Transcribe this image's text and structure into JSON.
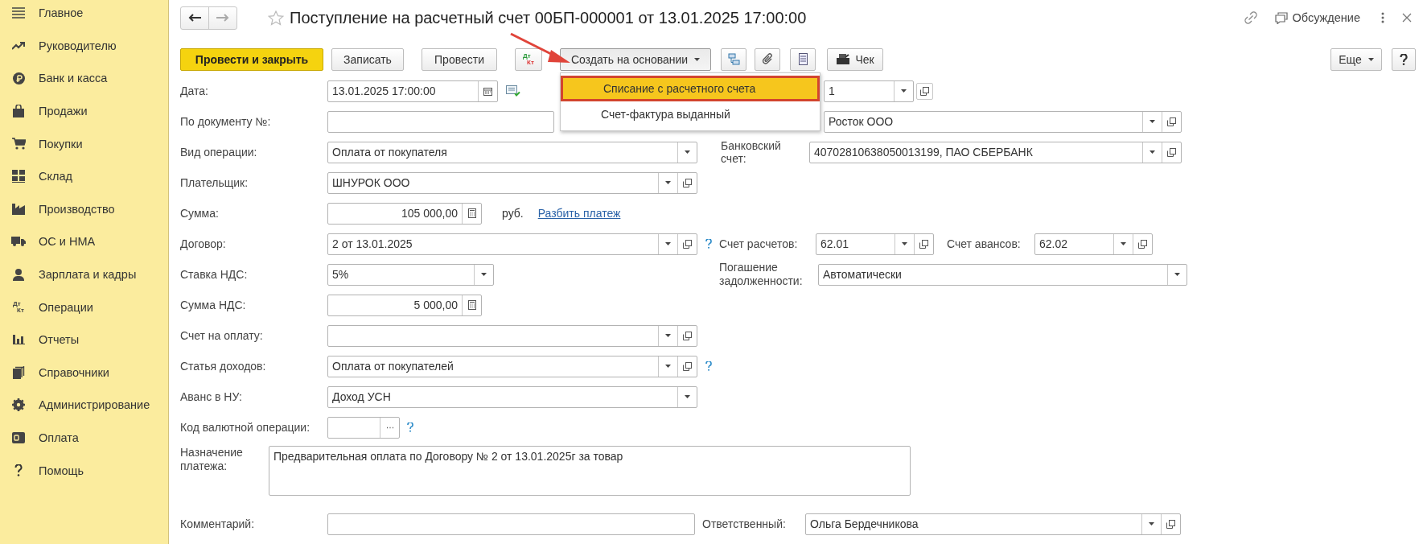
{
  "sidebar": {
    "items": [
      {
        "label": "Главное"
      },
      {
        "label": "Руководителю"
      },
      {
        "label": "Банк и касса"
      },
      {
        "label": "Продажи"
      },
      {
        "label": "Покупки"
      },
      {
        "label": "Склад"
      },
      {
        "label": "Производство"
      },
      {
        "label": "ОС и НМА"
      },
      {
        "label": "Зарплата и кадры"
      },
      {
        "label": "Операции",
        "icon_text": [
          "Дт",
          "Кт"
        ]
      },
      {
        "label": "Отчеты"
      },
      {
        "label": "Справочники"
      },
      {
        "label": "Администрирование"
      },
      {
        "label": "Оплата"
      },
      {
        "label": "Помощь"
      }
    ]
  },
  "header": {
    "title": "Поступление на расчетный счет 00БП-000001 от 13.01.2025 17:00:00",
    "discussion": "Обсуждение"
  },
  "toolbar": {
    "post_close": "Провести и закрыть",
    "save": "Записать",
    "post": "Провести",
    "dt_kt": [
      "Дт",
      "Кт"
    ],
    "create_based": "Создать на основании",
    "receipt": "Чек",
    "more": "Еще"
  },
  "create_menu": {
    "items": [
      {
        "label": "Списание с расчетного счета",
        "selected": true
      },
      {
        "label": "Счет-фактура выданный",
        "selected": false
      }
    ]
  },
  "form": {
    "date": {
      "label": "Дата:",
      "value": "13.01.2025 17:00:00"
    },
    "field_behind_menu_1": {
      "value": "1"
    },
    "doc_number": {
      "label": "По документу №:"
    },
    "field_behind_menu_2": {
      "value": "Росток ООО"
    },
    "operation": {
      "label": "Вид операции:",
      "value": "Оплата от покупателя"
    },
    "bank_account": {
      "label": "Банковский счет:",
      "value": "40702810638050013199, ПАО СБЕРБАНК"
    },
    "payer": {
      "label": "Плательщик:",
      "value": "ШНУРОК ООО"
    },
    "amount": {
      "label": "Сумма:",
      "value": "105 000,00",
      "currency": "руб.",
      "link": "Разбить платеж"
    },
    "contract": {
      "label": "Договор:",
      "value": "2 от 13.01.2025"
    },
    "settlement_account": {
      "label": "Счет расчетов:",
      "value": "62.01"
    },
    "advance_account": {
      "label": "Счет авансов:",
      "value": "62.02"
    },
    "vat_rate": {
      "label": "Ставка НДС:",
      "value": "5%"
    },
    "debt_repayment": {
      "label": "Погашение задолженности:",
      "value": "Автоматически"
    },
    "vat_amount": {
      "label": "Сумма НДС:",
      "value": "5 000,00"
    },
    "invoice": {
      "label": "Счет на оплату:"
    },
    "income_item": {
      "label": "Статья доходов:",
      "value": "Оплата от покупателей"
    },
    "advance_nu": {
      "label": "Аванс в НУ:",
      "value": "Доход УСН"
    },
    "currency_code": {
      "label": "Код валютной операции:"
    },
    "purpose": {
      "label": "Назначение платежа:",
      "value": "Предварительная оплата по Договору № 2 от 13.01.2025г за товар"
    },
    "comment": {
      "label": "Комментарий:"
    },
    "responsible": {
      "label": "Ответственный:",
      "value": "Ольга Бердечникова"
    }
  }
}
